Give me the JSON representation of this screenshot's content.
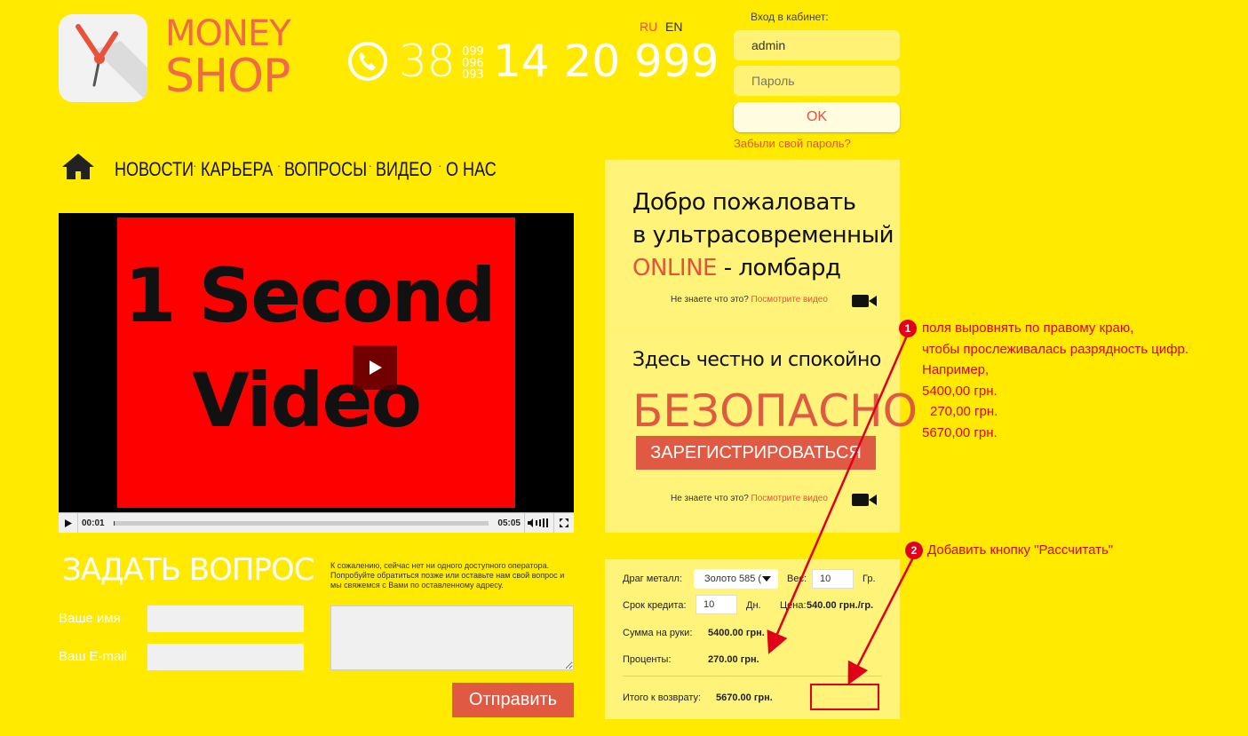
{
  "brand": {
    "line1": "MONEY",
    "line2": "SHOP"
  },
  "phone": {
    "code": "38",
    "operators": [
      "099",
      "096",
      "093"
    ],
    "number": "14 20 999"
  },
  "lang": {
    "ru": "RU",
    "en": "EN"
  },
  "login": {
    "title": "Вход в кабинет:",
    "username_value": "admin",
    "password_placeholder": "Пароль",
    "ok_label": "OK",
    "forgot_label": "Забыли свой пароль?"
  },
  "nav": {
    "items": [
      "НОВОСТИ",
      "КАРЬЕРА",
      "ВОПРОСЫ",
      "ВИДЕО",
      "О НАС"
    ],
    "separator": "·"
  },
  "video": {
    "title_line1": "1 Second",
    "title_line2": "Video",
    "current_time": "00:01",
    "duration": "05:05",
    "progress": 0.003
  },
  "ask": {
    "title": "ЗАДАТЬ ВОПРОС",
    "note": "К сожалению, сейчас нет ни одного доступного оператора. Попробуйте обратиться позже или оставьте нам свой вопрос и мы свяжемся с Вами по оставленному адресу.",
    "name_label": "Ваше имя",
    "email_label": "Ваш E-mail",
    "send_label": "Отправить"
  },
  "welcome": {
    "line1": "Добро пожаловать",
    "line2": "в ультрасовременный",
    "online": "ONLINE",
    "line3_rest": " - ломбард",
    "note_text": "Не знаете что это?",
    "note_link": "Посмотрите видео"
  },
  "safe": {
    "line": "Здесь честно и спокойно",
    "big": "БЕЗОПАСНО",
    "register_label": "ЗАРЕГИСТРИРОВАТЬСЯ",
    "note_text": "Не знаете что это?",
    "note_link": "Посмотрите видео"
  },
  "calc": {
    "metal_label": "Драг металл:",
    "metal_value": "Золото 585 (",
    "weight_label": "Вес:",
    "weight_value": "10",
    "weight_unit": "Гр.",
    "term_label": "Срок кредита:",
    "term_value": "10",
    "term_unit": "Дн.",
    "price_label": "Цена:",
    "price_value": "540.00 грн./гр.",
    "sum_label": "Сумма на руки:",
    "sum_value": "5400.00 грн.",
    "percent_label": "Проценты:",
    "percent_value": "270.00 грн.",
    "total_label": "Итого к возврату:",
    "total_value": "5670.00 грн."
  },
  "annotations": {
    "a1_num": "1",
    "a1_lines": [
      "поля выровнять по правому краю,",
      "чтобы прослеживалась разрядность цифр.",
      "Например,",
      "5400,00 грн.",
      "270,00 грн.",
      "5670,00 грн."
    ],
    "a2_num": "2",
    "a2_text": "Добавить кнопку \"Рассчитать\""
  },
  "colors": {
    "background": "#ffea00",
    "accent": "#e05a43",
    "annotation": "#e0001a"
  },
  "icons": [
    "clock-logo-icon",
    "phone-icon",
    "home-icon",
    "play-icon",
    "camera-icon",
    "volume-icon",
    "fullscreen-icon",
    "dropdown-arrow-icon"
  ]
}
